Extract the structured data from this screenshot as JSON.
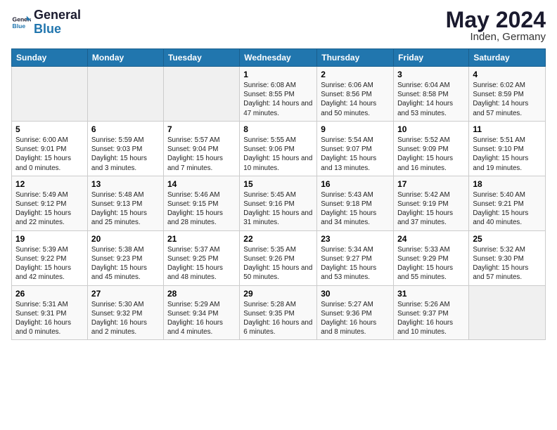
{
  "header": {
    "title": "May 2024",
    "location": "Inden, Germany"
  },
  "days": [
    "Sunday",
    "Monday",
    "Tuesday",
    "Wednesday",
    "Thursday",
    "Friday",
    "Saturday"
  ],
  "weeks": [
    [
      {
        "day": "",
        "info": ""
      },
      {
        "day": "",
        "info": ""
      },
      {
        "day": "",
        "info": ""
      },
      {
        "day": "1",
        "info": "Sunrise: 6:08 AM\nSunset: 8:55 PM\nDaylight: 14 hours\nand 47 minutes."
      },
      {
        "day": "2",
        "info": "Sunrise: 6:06 AM\nSunset: 8:56 PM\nDaylight: 14 hours\nand 50 minutes."
      },
      {
        "day": "3",
        "info": "Sunrise: 6:04 AM\nSunset: 8:58 PM\nDaylight: 14 hours\nand 53 minutes."
      },
      {
        "day": "4",
        "info": "Sunrise: 6:02 AM\nSunset: 8:59 PM\nDaylight: 14 hours\nand 57 minutes."
      }
    ],
    [
      {
        "day": "5",
        "info": "Sunrise: 6:00 AM\nSunset: 9:01 PM\nDaylight: 15 hours\nand 0 minutes."
      },
      {
        "day": "6",
        "info": "Sunrise: 5:59 AM\nSunset: 9:03 PM\nDaylight: 15 hours\nand 3 minutes."
      },
      {
        "day": "7",
        "info": "Sunrise: 5:57 AM\nSunset: 9:04 PM\nDaylight: 15 hours\nand 7 minutes."
      },
      {
        "day": "8",
        "info": "Sunrise: 5:55 AM\nSunset: 9:06 PM\nDaylight: 15 hours\nand 10 minutes."
      },
      {
        "day": "9",
        "info": "Sunrise: 5:54 AM\nSunset: 9:07 PM\nDaylight: 15 hours\nand 13 minutes."
      },
      {
        "day": "10",
        "info": "Sunrise: 5:52 AM\nSunset: 9:09 PM\nDaylight: 15 hours\nand 16 minutes."
      },
      {
        "day": "11",
        "info": "Sunrise: 5:51 AM\nSunset: 9:10 PM\nDaylight: 15 hours\nand 19 minutes."
      }
    ],
    [
      {
        "day": "12",
        "info": "Sunrise: 5:49 AM\nSunset: 9:12 PM\nDaylight: 15 hours\nand 22 minutes."
      },
      {
        "day": "13",
        "info": "Sunrise: 5:48 AM\nSunset: 9:13 PM\nDaylight: 15 hours\nand 25 minutes."
      },
      {
        "day": "14",
        "info": "Sunrise: 5:46 AM\nSunset: 9:15 PM\nDaylight: 15 hours\nand 28 minutes."
      },
      {
        "day": "15",
        "info": "Sunrise: 5:45 AM\nSunset: 9:16 PM\nDaylight: 15 hours\nand 31 minutes."
      },
      {
        "day": "16",
        "info": "Sunrise: 5:43 AM\nSunset: 9:18 PM\nDaylight: 15 hours\nand 34 minutes."
      },
      {
        "day": "17",
        "info": "Sunrise: 5:42 AM\nSunset: 9:19 PM\nDaylight: 15 hours\nand 37 minutes."
      },
      {
        "day": "18",
        "info": "Sunrise: 5:40 AM\nSunset: 9:21 PM\nDaylight: 15 hours\nand 40 minutes."
      }
    ],
    [
      {
        "day": "19",
        "info": "Sunrise: 5:39 AM\nSunset: 9:22 PM\nDaylight: 15 hours\nand 42 minutes."
      },
      {
        "day": "20",
        "info": "Sunrise: 5:38 AM\nSunset: 9:23 PM\nDaylight: 15 hours\nand 45 minutes."
      },
      {
        "day": "21",
        "info": "Sunrise: 5:37 AM\nSunset: 9:25 PM\nDaylight: 15 hours\nand 48 minutes."
      },
      {
        "day": "22",
        "info": "Sunrise: 5:35 AM\nSunset: 9:26 PM\nDaylight: 15 hours\nand 50 minutes."
      },
      {
        "day": "23",
        "info": "Sunrise: 5:34 AM\nSunset: 9:27 PM\nDaylight: 15 hours\nand 53 minutes."
      },
      {
        "day": "24",
        "info": "Sunrise: 5:33 AM\nSunset: 9:29 PM\nDaylight: 15 hours\nand 55 minutes."
      },
      {
        "day": "25",
        "info": "Sunrise: 5:32 AM\nSunset: 9:30 PM\nDaylight: 15 hours\nand 57 minutes."
      }
    ],
    [
      {
        "day": "26",
        "info": "Sunrise: 5:31 AM\nSunset: 9:31 PM\nDaylight: 16 hours\nand 0 minutes."
      },
      {
        "day": "27",
        "info": "Sunrise: 5:30 AM\nSunset: 9:32 PM\nDaylight: 16 hours\nand 2 minutes."
      },
      {
        "day": "28",
        "info": "Sunrise: 5:29 AM\nSunset: 9:34 PM\nDaylight: 16 hours\nand 4 minutes."
      },
      {
        "day": "29",
        "info": "Sunrise: 5:28 AM\nSunset: 9:35 PM\nDaylight: 16 hours\nand 6 minutes."
      },
      {
        "day": "30",
        "info": "Sunrise: 5:27 AM\nSunset: 9:36 PM\nDaylight: 16 hours\nand 8 minutes."
      },
      {
        "day": "31",
        "info": "Sunrise: 5:26 AM\nSunset: 9:37 PM\nDaylight: 16 hours\nand 10 minutes."
      },
      {
        "day": "",
        "info": ""
      }
    ]
  ]
}
